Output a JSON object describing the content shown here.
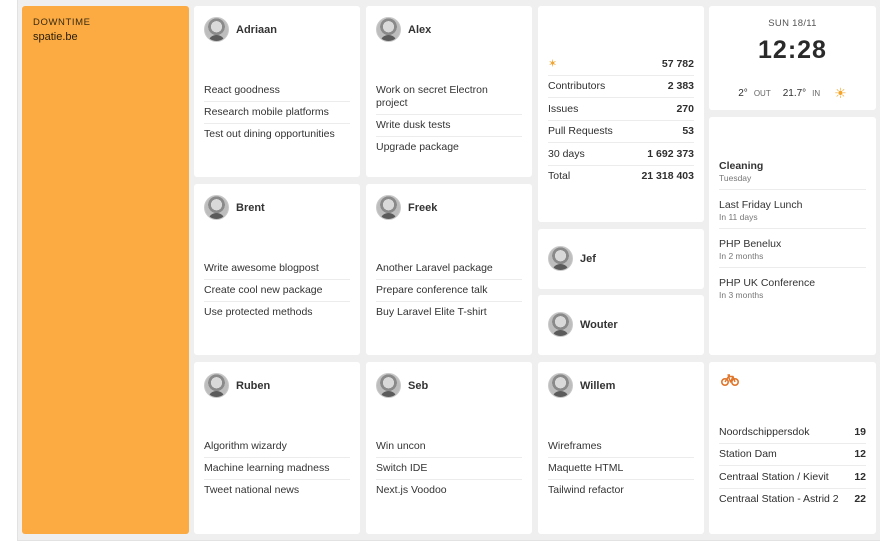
{
  "downtime": {
    "label": "DOWNTIME",
    "site": "spatie.be"
  },
  "people": [
    {
      "name": "Adriaan",
      "tasks": [
        "React goodness",
        "Research mobile platforms",
        "Test out dining opportunities"
      ]
    },
    {
      "name": "Alex",
      "tasks": [
        "Work on secret Electron project",
        "Write dusk tests",
        "Upgrade package"
      ]
    },
    {
      "name": "Brent",
      "tasks": [
        "Write awesome blogpost",
        "Create cool new package",
        "Use protected methods"
      ]
    },
    {
      "name": "Freek",
      "tasks": [
        "Another Laravel package",
        "Prepare conference talk",
        "Buy Laravel Elite T-shirt"
      ]
    },
    {
      "name": "Ruben",
      "tasks": [
        "Algorithm wizardy",
        "Machine learning madness",
        "Tweet national news"
      ]
    },
    {
      "name": "Seb",
      "tasks": [
        "Win uncon",
        "Switch IDE",
        "Next.js Voodoo"
      ]
    },
    {
      "name": "Willem",
      "tasks": [
        "Wireframes",
        "Maquette HTML",
        "Tailwind refactor"
      ]
    },
    {
      "name": "Jef",
      "tasks": []
    },
    {
      "name": "Wouter",
      "tasks": []
    }
  ],
  "stats": {
    "stars_icon": "star-icon",
    "stars": "57 782",
    "rows": [
      {
        "label": "Contributors",
        "value": "2 383"
      },
      {
        "label": "Issues",
        "value": "270"
      },
      {
        "label": "Pull Requests",
        "value": "53"
      },
      {
        "label": "30 days",
        "value": "1 692 373"
      },
      {
        "label": "Total",
        "value": "21 318 403"
      }
    ]
  },
  "clock": {
    "date": "SUN 18/11",
    "time": "12:28",
    "out_temp": "2°",
    "out_label": "OUT",
    "in_temp": "21.7°",
    "in_label": "IN",
    "weather_icon": "sun-icon"
  },
  "calendar": [
    {
      "title": "Cleaning",
      "sub": "Tuesday"
    },
    {
      "title": "Last Friday Lunch",
      "sub": "In 11 days"
    },
    {
      "title": "PHP Benelux",
      "sub": "In 2 months"
    },
    {
      "title": "PHP UK Conference",
      "sub": "In 3 months"
    }
  ],
  "bikes": {
    "icon": "bicycle-icon",
    "rows": [
      {
        "station": "Noordschippersdok",
        "count": "19"
      },
      {
        "station": "Station Dam",
        "count": "12"
      },
      {
        "station": "Centraal Station / Kievit",
        "count": "12"
      },
      {
        "station": "Centraal Station - Astrid 2",
        "count": "22"
      }
    ]
  },
  "colors": {
    "accent": "#fbab42",
    "background": "#efefef",
    "tile": "#ffffff"
  }
}
